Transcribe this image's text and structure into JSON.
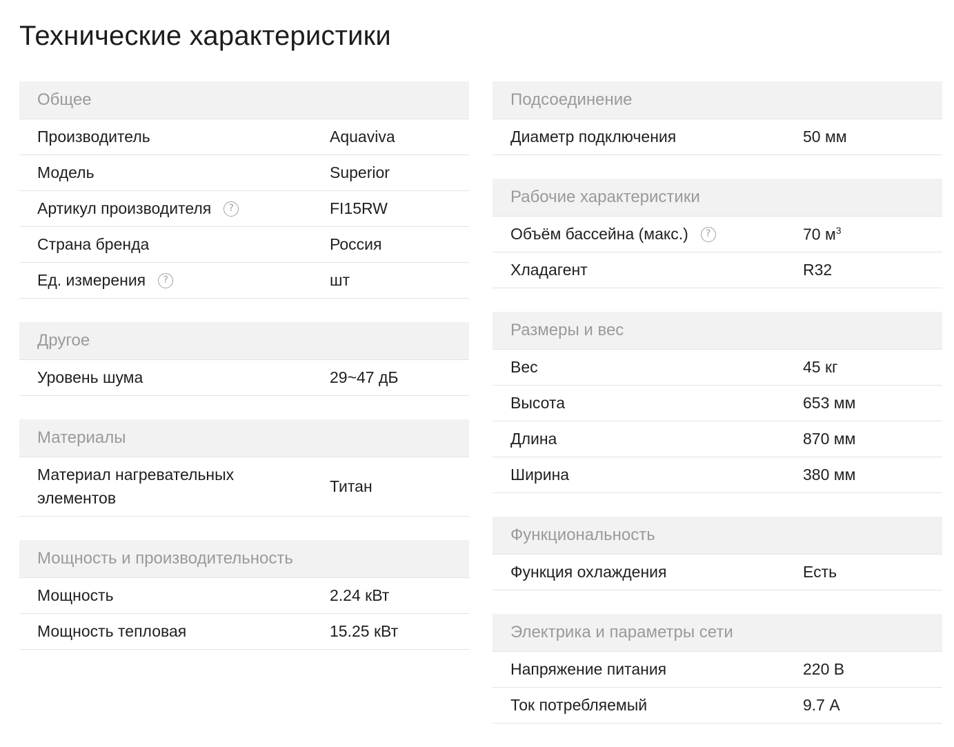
{
  "title": "Технические характеристики",
  "left_sections": [
    {
      "header": "Общее",
      "rows": [
        {
          "label": "Производитель",
          "value": "Aquaviva"
        },
        {
          "label": "Модель",
          "value": "Superior"
        },
        {
          "label": "Артикул производителя",
          "value": "FI15RW",
          "help_icon": "question-circle-icon"
        },
        {
          "label": "Страна бренда",
          "value": "Россия"
        },
        {
          "label": "Ед. измерения",
          "value": "шт",
          "help_icon": "question-circle-icon"
        }
      ]
    },
    {
      "header": "Другое",
      "rows": [
        {
          "label": "Уровень шума",
          "value": "29~47 дБ"
        }
      ]
    },
    {
      "header": "Материалы",
      "rows": [
        {
          "label_line1": "Материал нагревательных",
          "label_line2": "элементов",
          "value": "Титан"
        }
      ]
    },
    {
      "header": "Мощность и производительность",
      "rows": [
        {
          "label": "Мощность",
          "value": "2.24 кВт"
        },
        {
          "label": "Мощность тепловая",
          "value": "15.25 кВт"
        }
      ]
    }
  ],
  "right_sections": [
    {
      "header": "Подсоединение",
      "rows": [
        {
          "label": "Диаметр подключения",
          "value": "50 мм"
        }
      ]
    },
    {
      "header": "Рабочие характеристики",
      "rows": [
        {
          "label": "Объём бассейна (макс.)",
          "value": "70 м",
          "value_sup": "3",
          "help_icon": "question-circle-icon"
        },
        {
          "label": "Хладагент",
          "value": "R32"
        }
      ]
    },
    {
      "header": "Размеры и вес",
      "rows": [
        {
          "label": "Вес",
          "value": "45 кг"
        },
        {
          "label": "Высота",
          "value": "653 мм"
        },
        {
          "label": "Длина",
          "value": "870 мм"
        },
        {
          "label": "Ширина",
          "value": "380 мм"
        }
      ]
    },
    {
      "header": "Функциональность",
      "rows": [
        {
          "label": "Функция охлаждения",
          "value": "Есть"
        }
      ]
    },
    {
      "header": "Электрика и параметры сети",
      "rows": [
        {
          "label": "Напряжение питания",
          "value": "220 В"
        },
        {
          "label": "Ток потребляемый",
          "value": "9.7 А"
        }
      ]
    }
  ],
  "help_glyph": "?"
}
